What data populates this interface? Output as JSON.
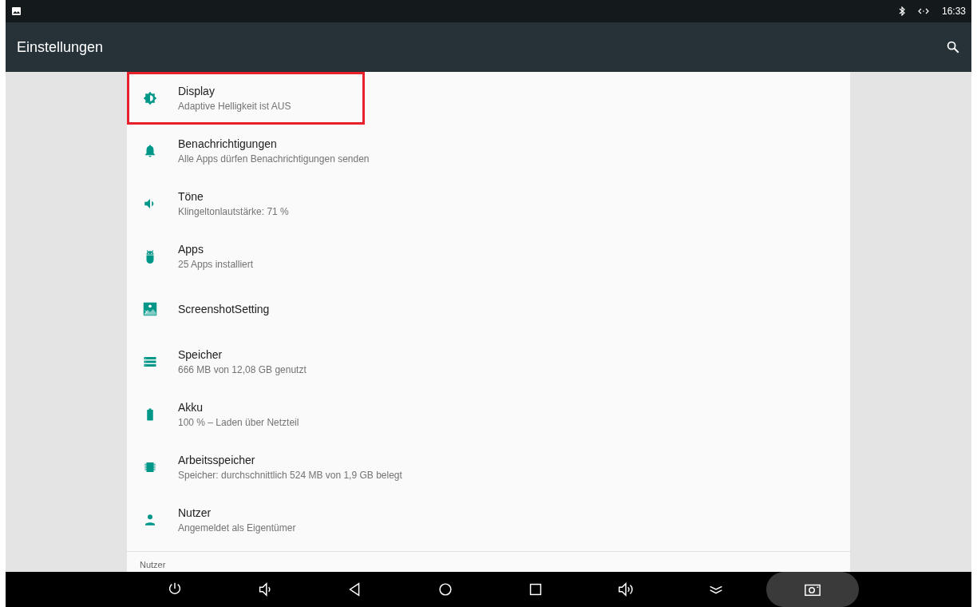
{
  "status_bar": {
    "time": "16:33"
  },
  "toolbar": {
    "title": "Einstellungen"
  },
  "settings": [
    {
      "kind": "brightness",
      "title": "Display",
      "summary": "Adaptive Helligkeit ist AUS",
      "highlighted": true
    },
    {
      "kind": "bell",
      "title": "Benachrichtigungen",
      "summary": "Alle Apps dürfen Benachrichtigungen senden",
      "highlighted": false
    },
    {
      "kind": "speaker",
      "title": "Töne",
      "summary": "Klingeltonlautstärke: 71 %",
      "highlighted": false
    },
    {
      "kind": "robot",
      "title": "Apps",
      "summary": "25 Apps installiert",
      "highlighted": false
    },
    {
      "kind": "image",
      "title": "ScreenshotSetting",
      "highlighted": false
    },
    {
      "kind": "storage",
      "title": "Speicher",
      "summary": "666 MB von 12,08 GB genutzt",
      "highlighted": false
    },
    {
      "kind": "battery",
      "title": "Akku",
      "summary": "100 % – Laden über Netzteil",
      "highlighted": false
    },
    {
      "kind": "chip",
      "title": "Arbeitsspeicher",
      "summary": "Speicher: durchschnittlich 524 MB von 1,9 GB belegt",
      "highlighted": false
    },
    {
      "kind": "person",
      "title": "Nutzer",
      "summary": "Angemeldet als Eigentümer",
      "highlighted": false
    }
  ],
  "section_header": "Nutzer",
  "nav_bar": [
    {
      "kind": "power"
    },
    {
      "kind": "volume-down"
    },
    {
      "kind": "back"
    },
    {
      "kind": "home"
    },
    {
      "kind": "recents"
    },
    {
      "kind": "volume-up"
    },
    {
      "kind": "collapse"
    },
    {
      "kind": "screenshot"
    }
  ]
}
